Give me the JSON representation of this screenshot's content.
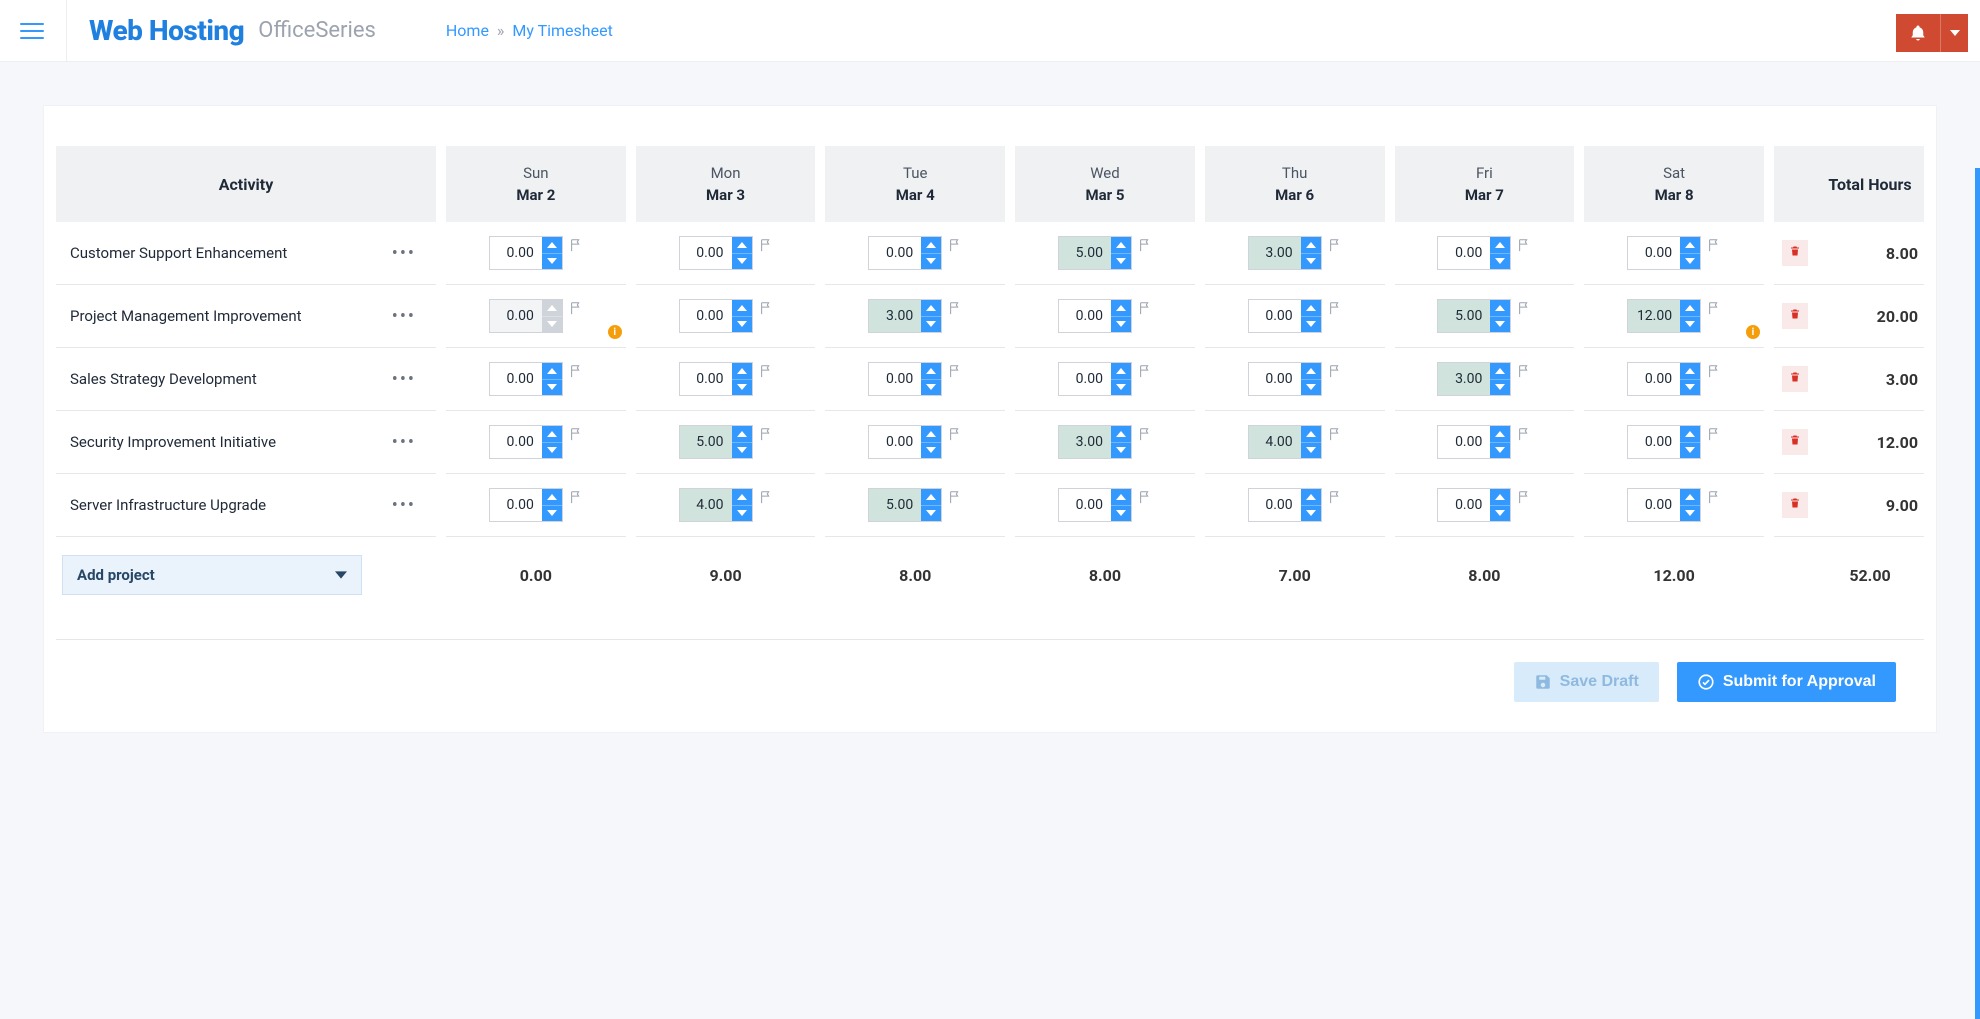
{
  "header": {
    "brand": "Web Hosting",
    "brandSub": "OfficeSeries",
    "breadcrumb": {
      "home": "Home",
      "current": "My Timesheet",
      "sep": "»"
    }
  },
  "table": {
    "activityHeader": "Activity",
    "totalHeader": "Total Hours",
    "days": [
      {
        "dow": "Sun",
        "date": "Mar 2"
      },
      {
        "dow": "Mon",
        "date": "Mar 3"
      },
      {
        "dow": "Tue",
        "date": "Mar 4"
      },
      {
        "dow": "Wed",
        "date": "Mar 5"
      },
      {
        "dow": "Thu",
        "date": "Mar 6"
      },
      {
        "dow": "Fri",
        "date": "Mar 7"
      },
      {
        "dow": "Sat",
        "date": "Mar 8"
      }
    ],
    "rows": [
      {
        "name": "Customer Support Enhancement",
        "cells": [
          {
            "val": "0.00",
            "filled": false
          },
          {
            "val": "0.00",
            "filled": false
          },
          {
            "val": "0.00",
            "filled": false
          },
          {
            "val": "5.00",
            "filled": true
          },
          {
            "val": "3.00",
            "filled": true
          },
          {
            "val": "0.00",
            "filled": false
          },
          {
            "val": "0.00",
            "filled": false
          }
        ],
        "total": "8.00"
      },
      {
        "name": "Project Management Improvement",
        "cells": [
          {
            "val": "0.00",
            "filled": false,
            "disabled": true,
            "warn": true
          },
          {
            "val": "0.00",
            "filled": false
          },
          {
            "val": "3.00",
            "filled": true
          },
          {
            "val": "0.00",
            "filled": false
          },
          {
            "val": "0.00",
            "filled": false
          },
          {
            "val": "5.00",
            "filled": true
          },
          {
            "val": "12.00",
            "filled": true,
            "warn": true
          }
        ],
        "total": "20.00"
      },
      {
        "name": "Sales Strategy Development",
        "cells": [
          {
            "val": "0.00",
            "filled": false
          },
          {
            "val": "0.00",
            "filled": false
          },
          {
            "val": "0.00",
            "filled": false
          },
          {
            "val": "0.00",
            "filled": false
          },
          {
            "val": "0.00",
            "filled": false
          },
          {
            "val": "3.00",
            "filled": true
          },
          {
            "val": "0.00",
            "filled": false
          }
        ],
        "total": "3.00"
      },
      {
        "name": "Security Improvement Initiative",
        "cells": [
          {
            "val": "0.00",
            "filled": false
          },
          {
            "val": "5.00",
            "filled": true
          },
          {
            "val": "0.00",
            "filled": false
          },
          {
            "val": "3.00",
            "filled": true
          },
          {
            "val": "4.00",
            "filled": true
          },
          {
            "val": "0.00",
            "filled": false
          },
          {
            "val": "0.00",
            "filled": false
          }
        ],
        "total": "12.00"
      },
      {
        "name": "Server Infrastructure Upgrade",
        "cells": [
          {
            "val": "0.00",
            "filled": false
          },
          {
            "val": "4.00",
            "filled": true
          },
          {
            "val": "5.00",
            "filled": true
          },
          {
            "val": "0.00",
            "filled": false
          },
          {
            "val": "0.00",
            "filled": false
          },
          {
            "val": "0.00",
            "filled": false
          },
          {
            "val": "0.00",
            "filled": false
          }
        ],
        "total": "9.00"
      }
    ],
    "footer": {
      "addProject": "Add project",
      "dayTotals": [
        "0.00",
        "9.00",
        "8.00",
        "8.00",
        "7.00",
        "8.00",
        "12.00"
      ],
      "grandTotal": "52.00"
    }
  },
  "actions": {
    "saveDraft": "Save Draft",
    "submit": "Submit for Approval"
  }
}
